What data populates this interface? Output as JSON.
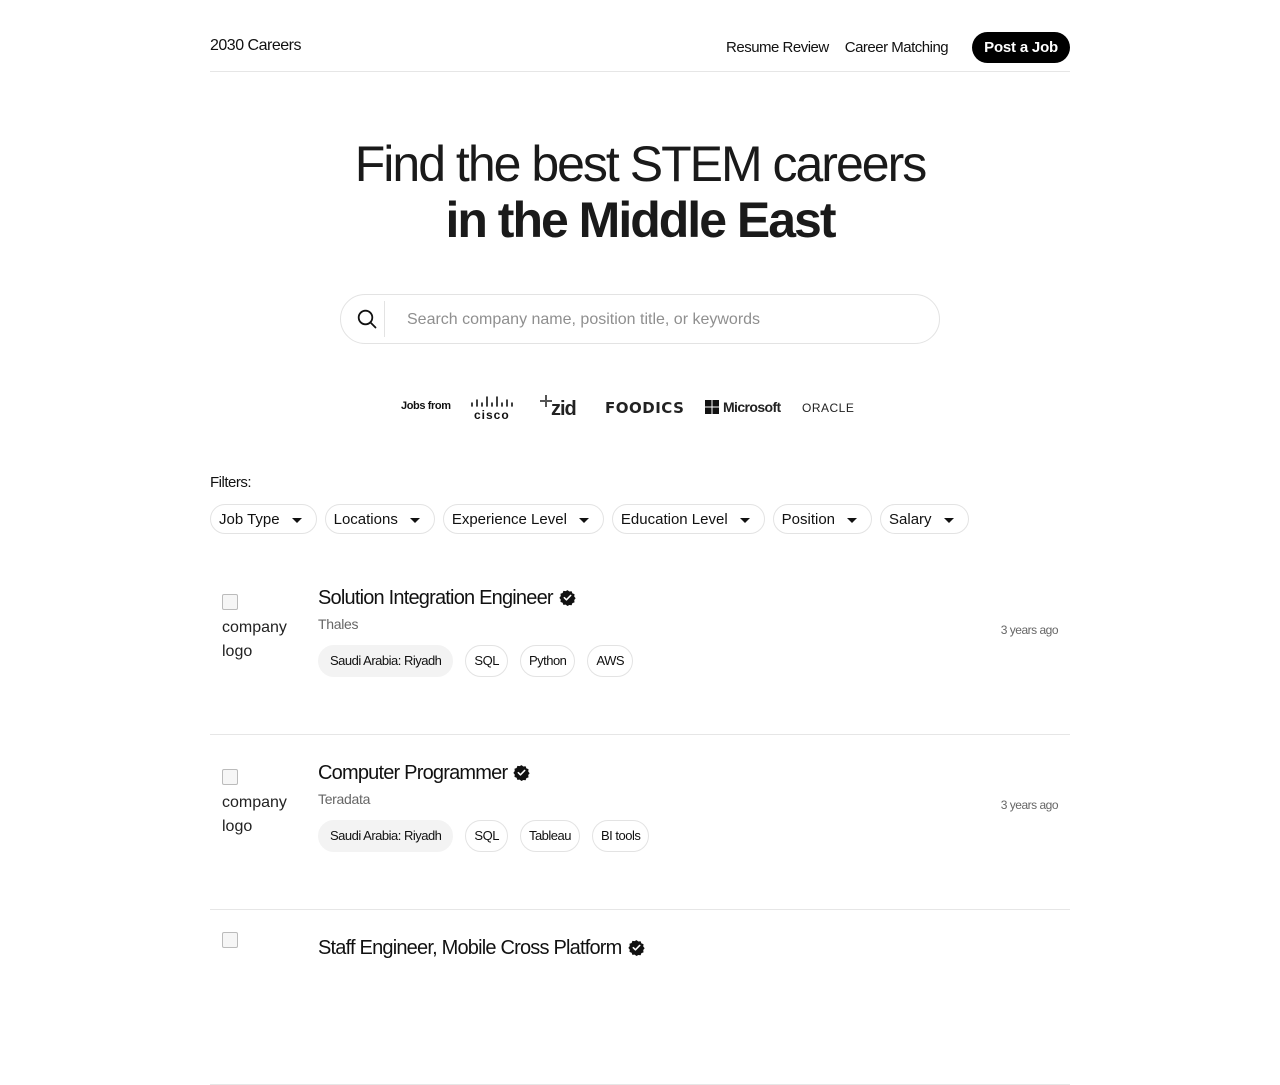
{
  "header": {
    "brand": "2030 Careers",
    "nav": [
      "Resume Review",
      "Career Matching"
    ],
    "post_button": "Post a Job"
  },
  "hero": {
    "line1": "Find the best STEM careers",
    "line2": "in the Middle East"
  },
  "search": {
    "placeholder": "Search company name, position title, or keywords",
    "value": ""
  },
  "logos": {
    "label": "Jobs from",
    "companies": [
      "cisco",
      "zid",
      "FOODICS",
      "Microsoft",
      "ORACLE"
    ]
  },
  "filters": {
    "title": "Filters:",
    "items": [
      "Job Type",
      "Locations",
      "Experience Level",
      "Education Level",
      "Position",
      "Salary"
    ]
  },
  "jobs": [
    {
      "logo_alt": "company logo",
      "title": "Solution Integration Engineer",
      "company": "Thales",
      "location": "Saudi Arabia: Riyadh",
      "tags": [
        "SQL",
        "Python",
        "AWS"
      ],
      "posted": "3 years ago"
    },
    {
      "logo_alt": "company logo",
      "title": "Computer Programmer",
      "company": "Teradata",
      "location": "Saudi Arabia: Riyadh",
      "tags": [
        "SQL",
        "Tableau",
        "BI tools"
      ],
      "posted": "3 years ago"
    },
    {
      "logo_alt": "company logo",
      "title": "Staff Engineer, Mobile Cross Platform",
      "company": "",
      "location": "",
      "tags": [],
      "posted": ""
    }
  ],
  "icons": {
    "search": "search-icon",
    "verified": "verified-badge-icon",
    "caret": "caret-down-icon"
  }
}
